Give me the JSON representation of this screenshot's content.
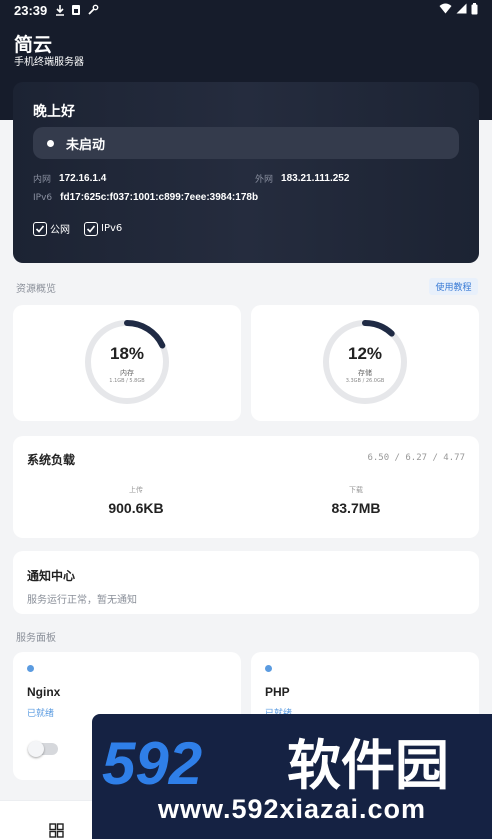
{
  "status_bar": {
    "time": "23:39",
    "icons": [
      "download-icon",
      "sim-icon",
      "wrench-icon"
    ],
    "right_icons": [
      "wifi-icon",
      "signal-icon",
      "battery-icon"
    ]
  },
  "app": {
    "title": "简云",
    "subtitle": "手机终端服务器"
  },
  "hero": {
    "greeting": "晚上好",
    "status": "未启动",
    "lan_label": "内网",
    "lan_ip": "172.16.1.4",
    "wan_label": "外网",
    "wan_ip": "183.21.111.252",
    "ipv6_label": "IPv6",
    "ipv6_value": "fd17:625c:f037:1001:c899:7eee:3984:178b",
    "checkbox_public": "公网",
    "checkbox_ipv6": "IPv6",
    "checkbox_public_checked": true,
    "checkbox_ipv6_checked": true
  },
  "resources": {
    "section_title": "资源概览",
    "tutorial_link": "使用教程",
    "memory": {
      "percent": "18%",
      "value": 0.18,
      "label": "内存",
      "detail": "1.1GB / 5.8GB"
    },
    "storage": {
      "percent": "12%",
      "value": 0.12,
      "label": "存储",
      "detail": "3.3GB / 26.0GB"
    },
    "gauge_color": "#1f2a44",
    "gauge_track_color": "#e6e7ea"
  },
  "load": {
    "title": "系统负载",
    "averages": "6.50 / 6.27 / 4.77",
    "upload_label": "上传",
    "upload_value": "900.6KB",
    "download_label": "下载",
    "download_value": "83.7MB"
  },
  "notice": {
    "title": "通知中心",
    "text": "服务运行正常，暂无通知"
  },
  "services": {
    "section_title": "服务面板",
    "items": [
      {
        "name": "Nginx",
        "status": "已就绪",
        "enabled": false
      },
      {
        "name": "PHP",
        "status": "已就绪"
      }
    ]
  },
  "watermark": {
    "brand_number": "592",
    "brand_text": "软件园",
    "url": "www.592xiazai.com",
    "colors": {
      "number": "#2f7fe8",
      "text": "#ffffff",
      "background": "#152243"
    }
  },
  "bottom_nav": {
    "icons": [
      "grid-icon"
    ]
  }
}
